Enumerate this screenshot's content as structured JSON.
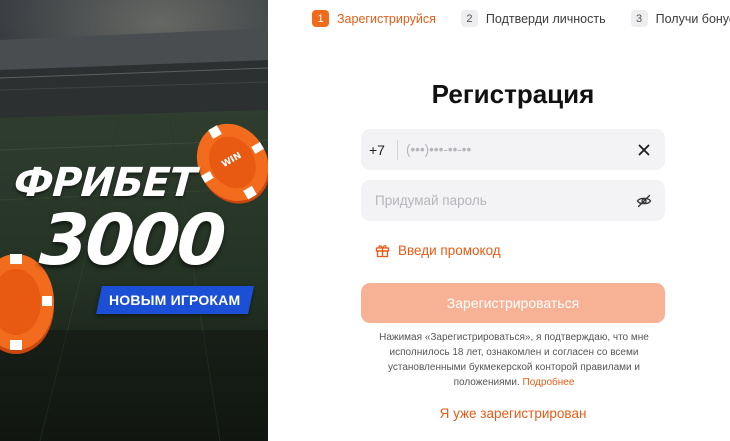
{
  "steps": [
    {
      "number": "1",
      "label": "Зарегистрируйся",
      "active": true
    },
    {
      "number": "2",
      "label": "Подтверди личность",
      "active": false
    },
    {
      "number": "3",
      "label": "Получи бонус",
      "active": false
    }
  ],
  "banner": {
    "headline": "ФРИБЕТ",
    "amount": "3000",
    "badge": "НОВЫМ ИГРОКАМ",
    "chip_text": "WIN"
  },
  "form": {
    "title": "Регистрация",
    "phone_prefix": "+7",
    "phone_placeholder": "(•••)•••-••-••",
    "password_placeholder": "Придумай пароль",
    "promo_link": "Введи промокод",
    "submit_label": "Зарегистрироваться",
    "terms_text": "Нажимая «Зарегистрироваться», я подтверждаю, что мне исполнилось 18 лет, ознакомлен и согласен со всеми установленными букмекерской конторой правилами и положениями.",
    "terms_link": "Подробнее",
    "login_link": "Я уже зарегистрирован"
  },
  "icons": {
    "clear": "close-icon",
    "visibility": "eye-hidden-icon",
    "promo": "gift-icon"
  },
  "colors": {
    "accent": "#e65c16",
    "step_active_bg": "#f26a1b",
    "submit_disabled": "#f7b295",
    "field_bg": "#f3f3f5",
    "badge_blue": "#1a4fd6"
  }
}
